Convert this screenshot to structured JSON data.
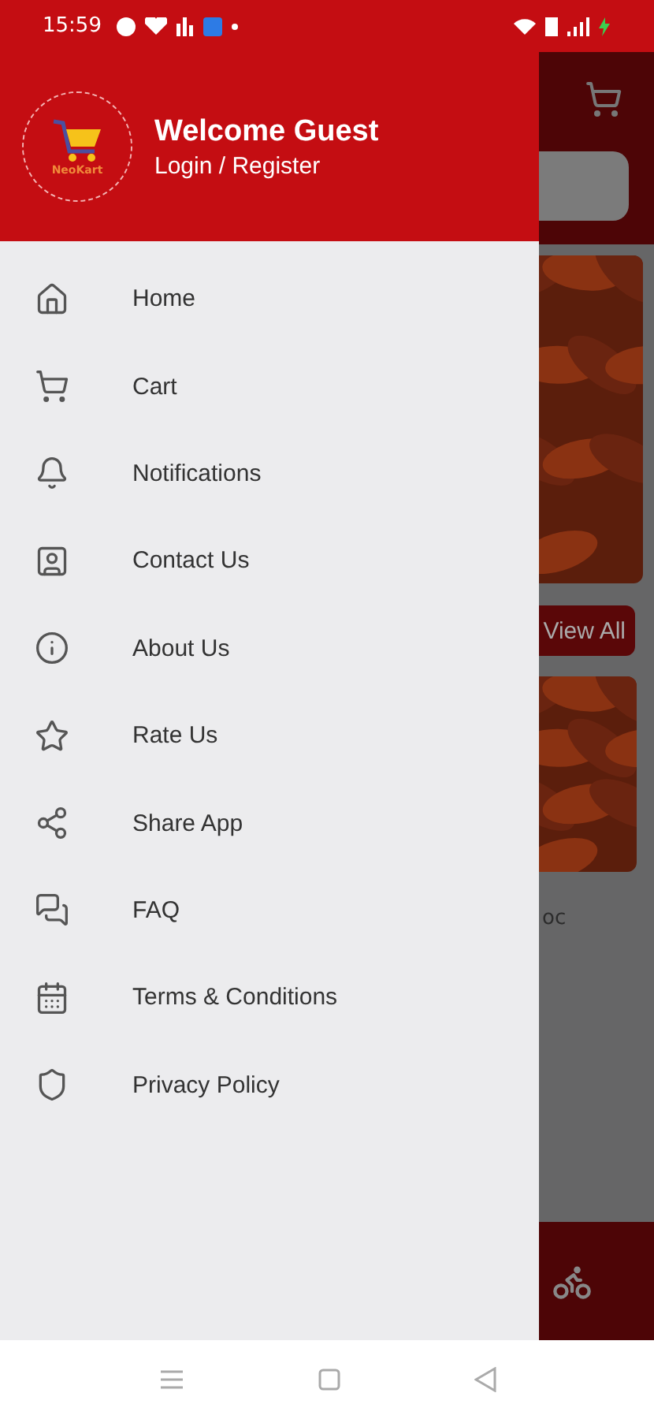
{
  "status_bar": {
    "time": "15:59"
  },
  "drawer": {
    "header": {
      "title": "Welcome Guest",
      "subtitle": "Login / Register",
      "logo_text": "NeoKart"
    },
    "items": [
      {
        "label": "Home"
      },
      {
        "label": "Cart"
      },
      {
        "label": "Notifications"
      },
      {
        "label": "Contact Us"
      },
      {
        "label": "About Us"
      },
      {
        "label": "Rate Us"
      },
      {
        "label": "Share App"
      },
      {
        "label": "FAQ"
      },
      {
        "label": "Terms & Conditions"
      },
      {
        "label": "Privacy Policy"
      }
    ]
  },
  "background_screen": {
    "view_all_button": "View All",
    "product_text": "oc"
  }
}
